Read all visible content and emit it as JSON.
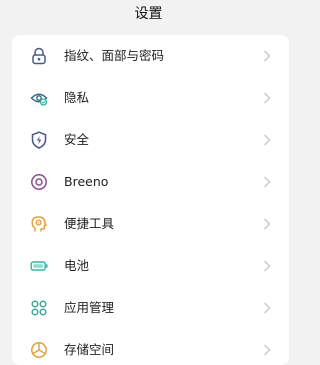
{
  "header": {
    "title": "设置"
  },
  "items": [
    {
      "label": "指纹、面部与密码",
      "icon": "lock-icon",
      "color": "#4a5a86"
    },
    {
      "label": "隐私",
      "icon": "privacy-eye-icon",
      "color": "#3d6a8a"
    },
    {
      "label": "安全",
      "icon": "shield-bolt-icon",
      "color": "#4a5a86"
    },
    {
      "label": "Breeno",
      "icon": "breeno-ring-icon",
      "color": "#8a4f8e"
    },
    {
      "label": "便捷工具",
      "icon": "tools-head-icon",
      "color": "#e0a23a"
    },
    {
      "label": "电池",
      "icon": "battery-icon",
      "color": "#39b8a4"
    },
    {
      "label": "应用管理",
      "icon": "apps-grid-icon",
      "color": "#3fa89a"
    },
    {
      "label": "存储空间",
      "icon": "storage-pie-icon",
      "color": "#e0a23a"
    }
  ],
  "colors": {
    "background": "#f2f2f2",
    "card": "#ffffff",
    "chevron": "#c8c8c8"
  }
}
